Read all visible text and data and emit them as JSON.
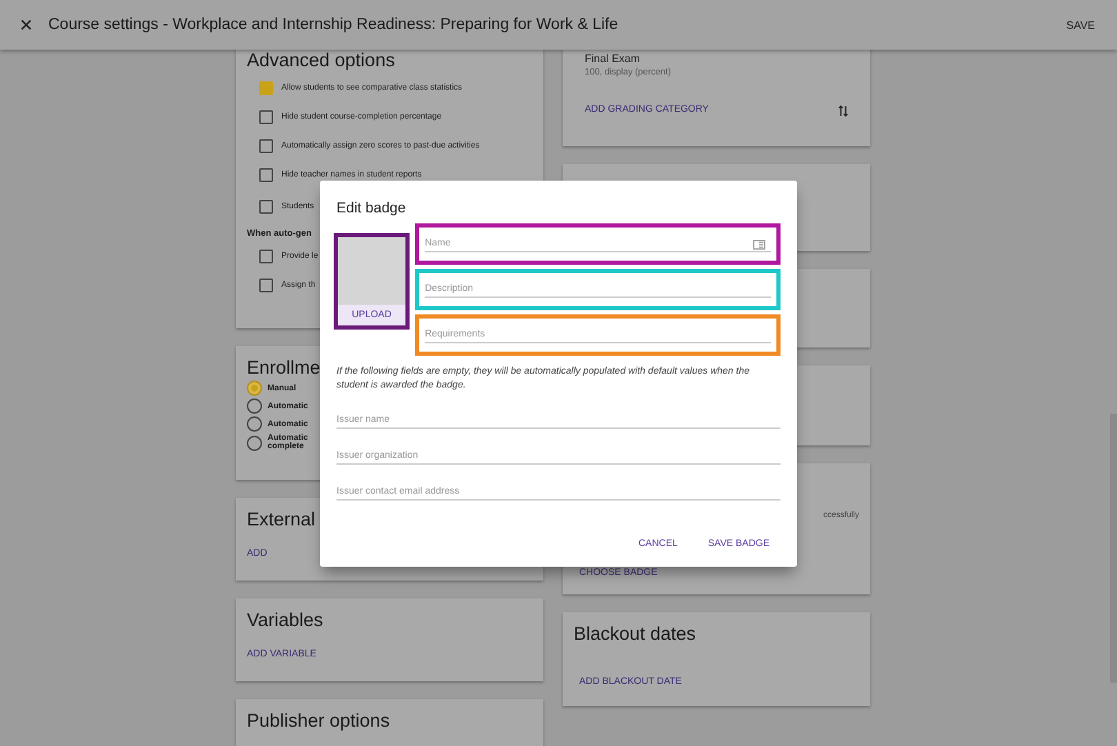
{
  "header": {
    "title": "Course settings - Workplace and Internship Readiness: Preparing for Work & Life",
    "save": "SAVE"
  },
  "left_cards": [
    {
      "kind": "checklist",
      "title": "Advanced options",
      "items": [
        {
          "label": "Allow students to see comparative class statistics",
          "checked": true
        },
        {
          "label": "Hide student course-completion percentage",
          "checked": false
        },
        {
          "label": "Automatically assign zero scores to past-due activities",
          "checked": false
        },
        {
          "label": "Hide teacher names in student reports",
          "checked": false
        },
        {
          "label": "Students",
          "checked": false
        }
      ],
      "subheading": "When auto-gen",
      "sub_items": [
        {
          "label": "Provide le",
          "checked": false
        },
        {
          "label": "Assign th",
          "checked": false
        }
      ]
    },
    {
      "kind": "radios",
      "title": "Enrollme",
      "options": [
        {
          "label": "Manual",
          "selected": true
        },
        {
          "label": "Automatic",
          "selected": false
        },
        {
          "label": "Automatic",
          "selected": false
        },
        {
          "label": "Automatic complete",
          "selected": false
        }
      ]
    },
    {
      "kind": "action",
      "title": "External",
      "action": "ADD"
    },
    {
      "kind": "action",
      "title": "Variables",
      "action": "ADD VARIABLE"
    },
    {
      "kind": "title",
      "title": "Publisher options"
    }
  ],
  "right_cards": [
    {
      "kind": "grading",
      "name": "Final Exam",
      "detail": "100, display (percent)",
      "action": "ADD GRADING CATEGORY"
    },
    {
      "kind": "empty"
    },
    {
      "kind": "empty"
    },
    {
      "kind": "empty"
    },
    {
      "kind": "badge",
      "text": "ccessfully",
      "action": "CHOOSE BADGE"
    },
    {
      "kind": "action",
      "title": "Blackout dates",
      "action": "ADD BLACKOUT DATE"
    }
  ],
  "dialog": {
    "title": "Edit badge",
    "upload": "UPLOAD",
    "fields": [
      {
        "placeholder": "Name",
        "color": "#b0189e"
      },
      {
        "placeholder": "Description",
        "color": "#1ec8c8"
      },
      {
        "placeholder": "Requirements",
        "color": "#f08a24"
      }
    ],
    "note": "If the following fields are empty, they will be automatically populated with default values when the student is awarded the badge.",
    "issuer_fields": [
      {
        "placeholder": "Issuer name"
      },
      {
        "placeholder": "Issuer organization"
      },
      {
        "placeholder": "Issuer contact email address"
      }
    ],
    "buttons": [
      "CANCEL",
      "SAVE BADGE"
    ]
  }
}
